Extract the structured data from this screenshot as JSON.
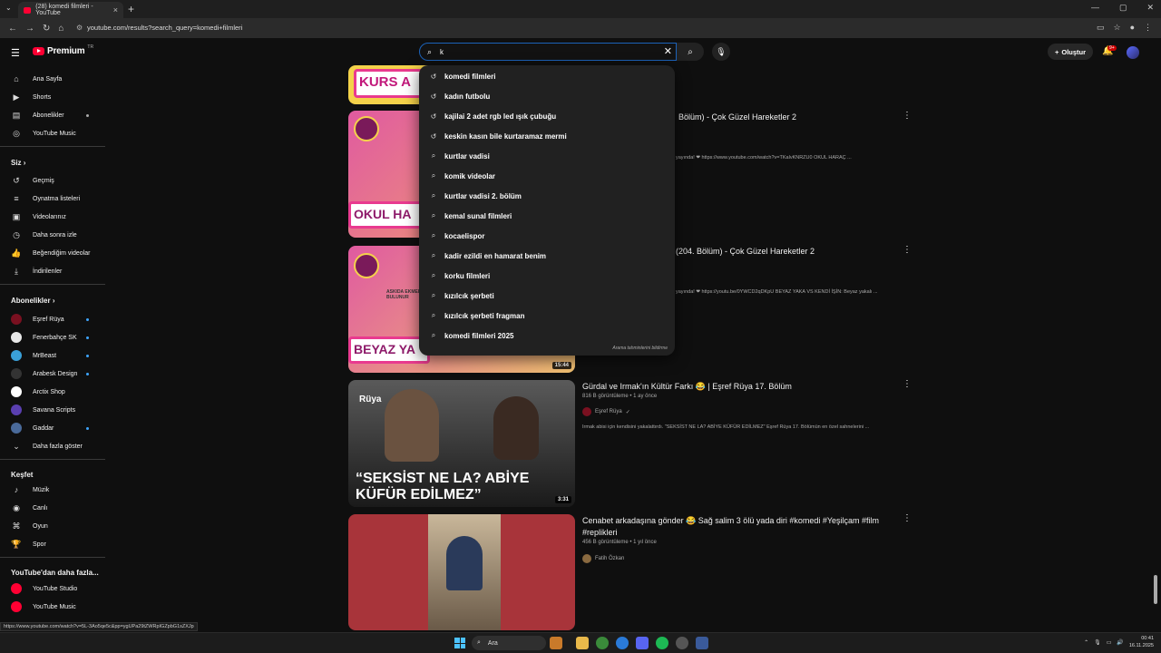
{
  "browser": {
    "tab_title": "(28) komedi filmleri - YouTube",
    "tab_close": "×",
    "new_tab": "+",
    "url": "youtube.com/results?search_query=komedi+filmleri",
    "window_controls": [
      "—",
      "▢",
      "✕"
    ]
  },
  "masthead": {
    "logo_text": "Premium",
    "logo_region": "TR",
    "search_value": "k",
    "create_label": "Oluştur",
    "notif_badge": "9+"
  },
  "sidebar": {
    "main": [
      {
        "label": "Ana Sayfa",
        "icon": "home-icon"
      },
      {
        "label": "Shorts",
        "icon": "shorts-icon"
      },
      {
        "label": "Abonelikler",
        "icon": "subscriptions-icon"
      },
      {
        "label": "YouTube Music",
        "icon": "music-icon"
      }
    ],
    "you_heading": "Siz",
    "you": [
      {
        "label": "Geçmiş",
        "icon": "history-icon"
      },
      {
        "label": "Oynatma listeleri",
        "icon": "playlist-icon"
      },
      {
        "label": "Videolarınız",
        "icon": "your-videos-icon"
      },
      {
        "label": "Daha sonra izle",
        "icon": "watch-later-icon"
      },
      {
        "label": "Beğendiğim videolar",
        "icon": "like-icon"
      },
      {
        "label": "İndirilenler",
        "icon": "download-icon"
      }
    ],
    "subs_heading": "Abonelikler",
    "subs": [
      {
        "label": "Eşref Rüya",
        "color": "#7a1020"
      },
      {
        "label": "Fenerbahçe SK",
        "color": "#e8e8e8"
      },
      {
        "label": "MrBeast",
        "color": "#3aa0d8"
      },
      {
        "label": "Arabesk Design",
        "color": "#333333"
      },
      {
        "label": "Arctix Shop",
        "color": "#ffffff"
      },
      {
        "label": "Savana Scripts",
        "color": "#5a3fb0"
      },
      {
        "label": "Gaddar",
        "color": "#4a6a9a"
      }
    ],
    "show_more": "Daha fazla göster",
    "explore_heading": "Keşfet",
    "explore": [
      {
        "label": "Müzik",
        "icon": "music-note-icon"
      },
      {
        "label": "Canlı",
        "icon": "live-icon"
      },
      {
        "label": "Oyun",
        "icon": "gaming-icon"
      },
      {
        "label": "Spor",
        "icon": "trophy-icon"
      }
    ],
    "more_heading": "YouTube'dan daha fazla...",
    "more": [
      {
        "label": "YouTube Studio"
      },
      {
        "label": "YouTube Music"
      }
    ]
  },
  "suggestions": {
    "items": [
      {
        "label": "komedi filmleri",
        "type": "history"
      },
      {
        "label": "kadın futbolu",
        "type": "history"
      },
      {
        "label": "kajilai 2 adet rgb led ışık çubuğu",
        "type": "history"
      },
      {
        "label": "keskin kasın bile kurtaramaz mermi",
        "type": "history"
      },
      {
        "label": "kurtlar vadisi",
        "type": "search"
      },
      {
        "label": "komik videolar",
        "type": "search"
      },
      {
        "label": "kurtlar vadisi 2. bölüm",
        "type": "search"
      },
      {
        "label": "kemal sunal filmleri",
        "type": "search"
      },
      {
        "label": "kocaelispor",
        "type": "search"
      },
      {
        "label": "kadir ezildi en hamarat benim",
        "type": "search"
      },
      {
        "label": "korku filmleri",
        "type": "search"
      },
      {
        "label": "kızılcık şerbeti",
        "type": "search"
      },
      {
        "label": "kızılcık şerbeti fragman",
        "type": "search"
      },
      {
        "label": "komedi filmleri 2025",
        "type": "search"
      }
    ],
    "footer": "Arama tahminlerini bildirme"
  },
  "videos": [
    {
      "thumb_text": "KURS A"
    },
    {
      "thumb_text": "OKUL HA",
      "badge_top": "",
      "title": "Bölüm) - Çok Güzel Hareketler 2",
      "desc": "yayında! ❤ https://www.youtube.com/watch?v=TKalvKNRZU0 OKUL HARAÇ ..."
    },
    {
      "thumb_text": "BEYAZ YA",
      "small_text": "ASKIDA EKMEK BULUNUR",
      "duration": "15:44",
      "title": "(204. Bölüm) - Çok Güzel Hareketler 2",
      "desc": "yayında! ❤ https://youtu.be/0YWCD2qDKpU BEYAZ YAKA VS KENDİ İŞİN: Beyaz yakalı ..."
    },
    {
      "thumb_text": "“SEKSİST NE LA? ABİYE KÜFÜR EDİLMEZ”",
      "channel_tag": "Rüya",
      "duration": "3:31",
      "title": "Gürdal ve Irmak'ın Kültür Farkı 😂 | Eşref Rüya 17. Bölüm",
      "meta": "816 B görüntüleme • 1 ay önce",
      "channel": "Eşref Rüya",
      "desc": "Irmak abisi için kendisini yakalattırdı. \"SEKSİST NE LA? ABİYE KÜFÜR EDİLMEZ\" Eşref Rüya 17. Bölümün en özel sahnelerini ..."
    },
    {
      "title": "Cenabet arkadaşına gönder 😂 Sağ salim 3 ölü yada diri #komedi #Yeşilçam #film #replikleri",
      "meta": "456 B görüntüleme • 1 yıl önce",
      "channel": "Fatih Özkan"
    }
  ],
  "status_url": "https://www.youtube.com/watch?v=5L-3Ao5qe5c&pp=ygUPa29tZWRpIGZpbG1sZXJp",
  "taskbar": {
    "search_label": "Ara",
    "time": "00:41",
    "date": "16.11.2025"
  }
}
